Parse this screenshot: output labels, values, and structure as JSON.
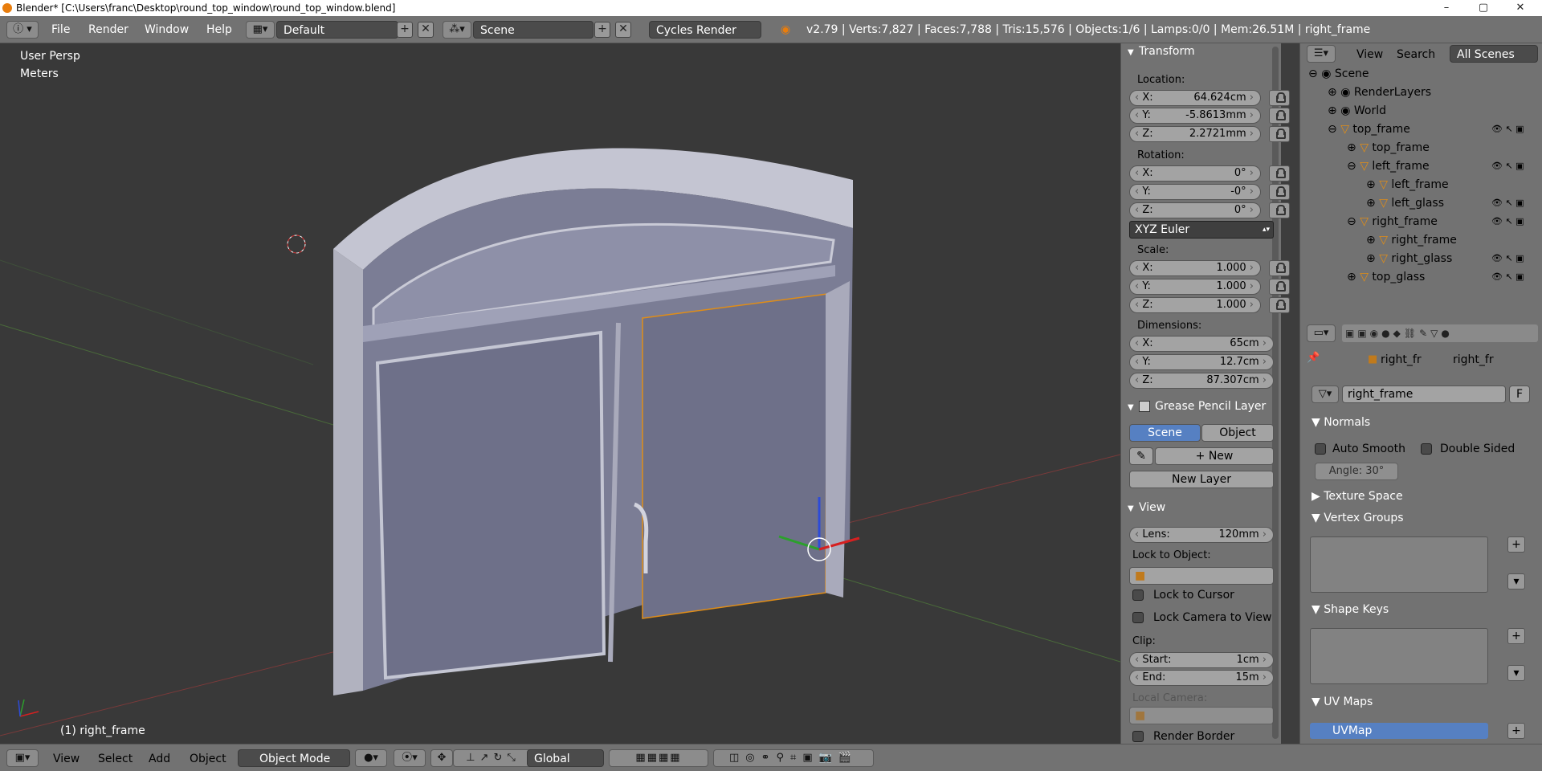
{
  "window": {
    "title": "Blender* [C:\\Users\\franc\\Desktop\\round_top_window\\round_top_window.blend]",
    "min": "–",
    "max": "▢",
    "close": "✕"
  },
  "topbar": {
    "menus": [
      "File",
      "Render",
      "Window",
      "Help"
    ],
    "layout": "Default",
    "scene": "Scene",
    "engine": "Cycles Render",
    "stats": "v2.79 | Verts:7,827 | Faces:7,788 | Tris:15,576 | Objects:1/6 | Lamps:0/0 | Mem:26.51M | right_frame"
  },
  "viewport": {
    "persp": "User Persp",
    "units": "Meters",
    "active_object": "(1) right_frame"
  },
  "transform": {
    "header": "Transform",
    "location_label": "Location:",
    "location": [
      {
        "ax": "X:",
        "v": "64.624cm"
      },
      {
        "ax": "Y:",
        "v": "-5.8613mm"
      },
      {
        "ax": "Z:",
        "v": "2.2721mm"
      }
    ],
    "rotation_label": "Rotation:",
    "rotation": [
      {
        "ax": "X:",
        "v": "0°"
      },
      {
        "ax": "Y:",
        "v": "-0°"
      },
      {
        "ax": "Z:",
        "v": "0°"
      }
    ],
    "rotation_mode": "XYZ Euler",
    "scale_label": "Scale:",
    "scale": [
      {
        "ax": "X:",
        "v": "1.000"
      },
      {
        "ax": "Y:",
        "v": "1.000"
      },
      {
        "ax": "Z:",
        "v": "1.000"
      }
    ],
    "dimensions_label": "Dimensions:",
    "dimensions": [
      {
        "ax": "X:",
        "v": "65cm"
      },
      {
        "ax": "Y:",
        "v": "12.7cm"
      },
      {
        "ax": "Z:",
        "v": "87.307cm"
      }
    ]
  },
  "grease": {
    "header": "Grease Pencil Layer",
    "tab_scene": "Scene",
    "tab_object": "Object",
    "new": "New",
    "new_layer": "New Layer"
  },
  "view": {
    "header": "View",
    "lens_label": "Lens:",
    "lens": "120mm",
    "lock_to_object": "Lock to Object:",
    "lock_cursor": "Lock to Cursor",
    "lock_camera": "Lock Camera to View",
    "clip": "Clip:",
    "start_label": "Start:",
    "start": "1cm",
    "end_label": "End:",
    "end": "15m",
    "local_camera": "Local Camera:",
    "render_border": "Render Border"
  },
  "outliner": {
    "view": "View",
    "search": "Search",
    "filter": "All Scenes",
    "rows": [
      {
        "name": "Scene",
        "indent": 0
      },
      {
        "name": "RenderLayers",
        "indent": 1
      },
      {
        "name": "World",
        "indent": 1
      },
      {
        "name": "top_frame",
        "indent": 1
      },
      {
        "name": "top_frame",
        "indent": 2
      },
      {
        "name": "left_frame",
        "indent": 2
      },
      {
        "name": "left_frame",
        "indent": 3
      },
      {
        "name": "left_glass",
        "indent": 3
      },
      {
        "name": "right_frame",
        "indent": 2
      },
      {
        "name": "right_frame",
        "indent": 3
      },
      {
        "name": "right_glass",
        "indent": 3
      },
      {
        "name": "top_glass",
        "indent": 2
      }
    ]
  },
  "data_props": {
    "breadcrumb_a": "right_fr",
    "breadcrumb_b": "right_fr",
    "mesh_name": "right_frame",
    "fake_user": "F",
    "normals": "Normals",
    "auto_smooth": "Auto Smooth",
    "double_sided": "Double Sided",
    "angle": "Angle:   30°",
    "texture_space": "Texture Space",
    "vertex_groups": "Vertex Groups",
    "shape_keys": "Shape Keys",
    "uv_maps": "UV Maps",
    "uv_map_name": "UVMap"
  },
  "bottombar": {
    "menus": [
      "View",
      "Select",
      "Add",
      "Object"
    ],
    "mode": "Object Mode",
    "orientation": "Global"
  },
  "colors": {
    "panel": "#727272",
    "viewport": "#393939",
    "selected": "#5680c2",
    "accent": "#e87d0d"
  }
}
